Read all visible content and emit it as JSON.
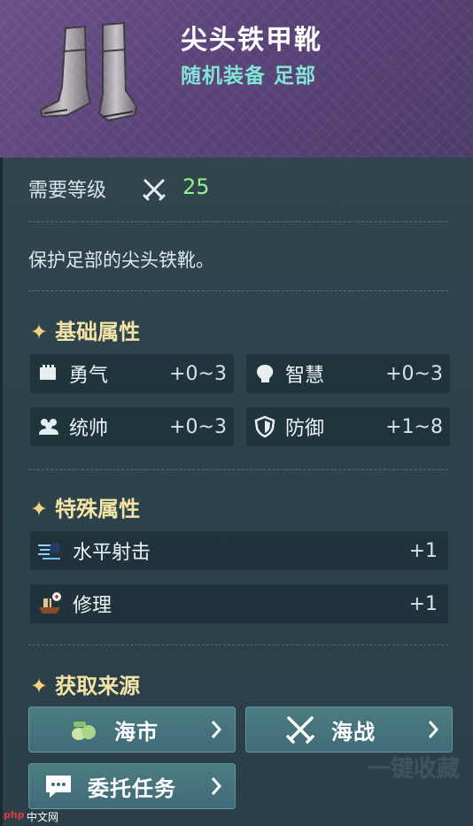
{
  "item": {
    "name": "尖头铁甲靴",
    "type": "随机装备 足部",
    "image_icon": "iron-boots-icon"
  },
  "requirement": {
    "label": "需要等级",
    "icon": "crossed-swords-icon",
    "value": "25"
  },
  "description": "保护足部的尖头铁靴。",
  "base_stats": {
    "title": "基础属性",
    "items": [
      {
        "icon": "courage-icon",
        "label": "勇气",
        "value": "+0~3"
      },
      {
        "icon": "wisdom-icon",
        "label": "智慧",
        "value": "+0~3"
      },
      {
        "icon": "command-icon",
        "label": "统帅",
        "value": "+0~3"
      },
      {
        "icon": "defense-shield-icon",
        "label": "防御",
        "value": "+1~8"
      }
    ]
  },
  "special_stats": {
    "title": "特殊属性",
    "items": [
      {
        "icon": "horizontal-shot-icon",
        "label": "水平射击",
        "value": "+1"
      },
      {
        "icon": "ship-repair-icon",
        "label": "修理",
        "value": "+1"
      }
    ]
  },
  "sources": {
    "title": "获取来源",
    "buttons": [
      {
        "icon": "money-bags-icon",
        "label": "海市"
      },
      {
        "icon": "crossed-swords-icon",
        "label": "海战"
      },
      {
        "icon": "chat-bubble-icon",
        "label": "委托任务"
      }
    ]
  },
  "background_text": "一键收藏",
  "watermark": {
    "logo": "php",
    "text": "中文网"
  },
  "colors": {
    "header_bg": "#5a4378",
    "item_type": "#7fe4d4",
    "level_value": "#92f28a",
    "section_title": "#f3e3a6",
    "button_bg": "#4d7b84"
  }
}
